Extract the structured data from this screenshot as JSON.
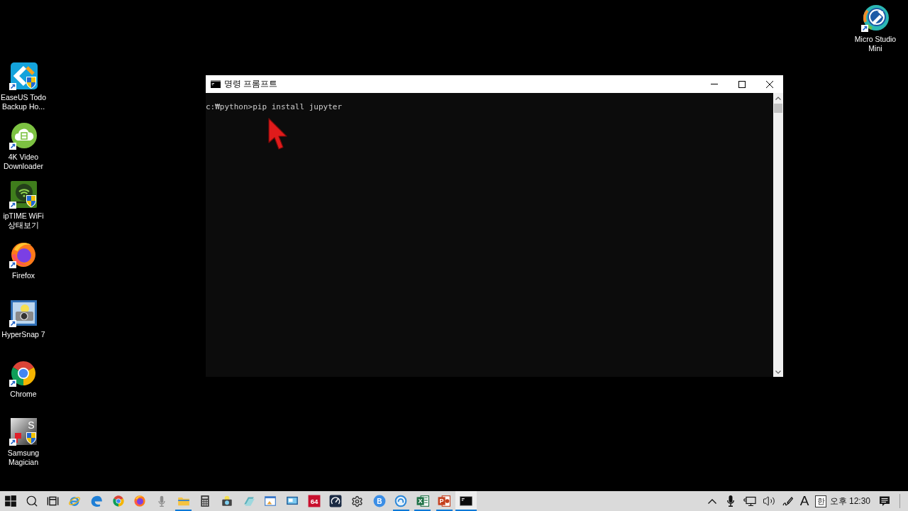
{
  "desktop_icons": [
    {
      "label": "EaseUS Todo Backup Ho..."
    },
    {
      "label": "4K Video Downloader"
    },
    {
      "label": "ipTIME WiFi 상태보기"
    },
    {
      "label": "Firefox"
    },
    {
      "label": "HyperSnap 7"
    },
    {
      "label": "Chrome"
    },
    {
      "label": "Samsung Magician",
      "logo_text": "S"
    }
  ],
  "corner_icon": {
    "label": "Micro Studio Mini"
  },
  "window": {
    "title": "명령 프롬프트",
    "lines": [
      "c:₩python>pip install jupyter"
    ]
  },
  "taskbar": {
    "apps": [
      {
        "running": false,
        "selected": false
      },
      {
        "running": false,
        "selected": false
      },
      {
        "running": false,
        "selected": false
      },
      {
        "running": false,
        "selected": false
      },
      {
        "running": false,
        "selected": false
      },
      {
        "running": true,
        "selected": false
      },
      {
        "running": false,
        "selected": false
      },
      {
        "running": false,
        "selected": false
      },
      {
        "running": false,
        "selected": false
      },
      {
        "running": false,
        "selected": false
      },
      {
        "running": false,
        "selected": false
      },
      {
        "running": false,
        "selected": false,
        "logo_text": "64"
      },
      {
        "running": false,
        "selected": false
      },
      {
        "running": false,
        "selected": false
      },
      {
        "running": false,
        "selected": false,
        "logo_text": "B"
      },
      {
        "running": true,
        "selected": false
      },
      {
        "running": true,
        "selected": false,
        "logo_text": "X"
      },
      {
        "running": true,
        "selected": false,
        "logo_text": "P"
      },
      {
        "running": true,
        "selected": true
      }
    ],
    "tray": {
      "input_mode": "A",
      "ime": "한",
      "clock": "오후 12:30"
    }
  }
}
